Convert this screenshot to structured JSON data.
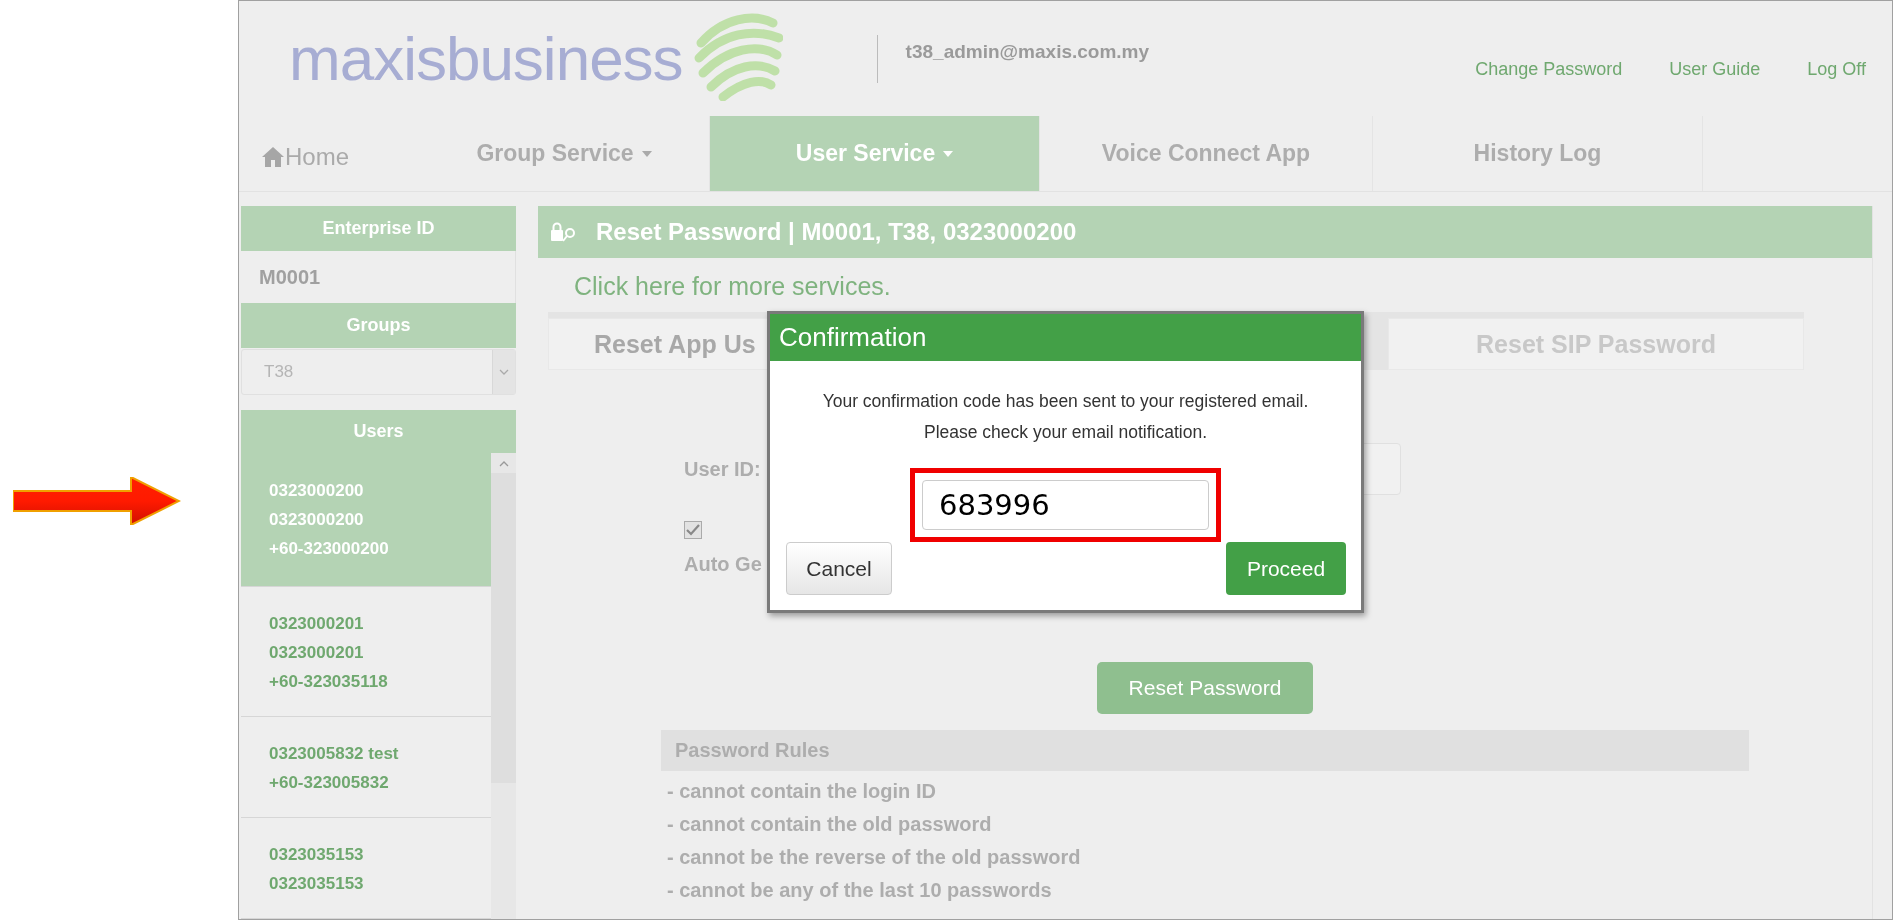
{
  "header": {
    "logo": "**maxis**business",
    "user_email": "t38_admin@maxis.com.my",
    "links": [
      "Change Password",
      "User Guide",
      "Log Off"
    ]
  },
  "nav": [
    {
      "label": "Home",
      "kind": "home",
      "selected": false,
      "dropdown": false
    },
    {
      "label": "Group Service",
      "kind": "menu",
      "selected": false,
      "dropdown": true
    },
    {
      "label": "User Service",
      "kind": "menu",
      "selected": true,
      "dropdown": true
    },
    {
      "label": "Voice Connect App",
      "kind": "menu",
      "selected": false,
      "dropdown": false
    },
    {
      "label": "History Log",
      "kind": "menu",
      "selected": false,
      "dropdown": false
    }
  ],
  "sidebar": {
    "enterprise_header": "Enterprise ID",
    "enterprise_id": "M0001",
    "groups_header": "Groups",
    "group_select": {
      "value": "T38"
    },
    "users_header": "Users",
    "users": [
      {
        "lines": [
          "0323000200",
          "0323000200",
          "+60-323000200"
        ],
        "selected": true
      },
      {
        "lines": [
          "0323000201",
          "0323000201",
          "+60-323035118"
        ],
        "selected": false
      },
      {
        "lines": [
          "0323005832 test",
          "+60-323005832"
        ],
        "selected": false
      },
      {
        "lines": [
          "0323035153",
          "0323035153"
        ],
        "selected": false
      }
    ]
  },
  "main": {
    "title": "Reset Password | M0001, T38, 0323000200",
    "services_link": "Click here for more services.",
    "tabs": [
      {
        "label": "Reset App Us",
        "selected": true
      },
      {
        "label": "Reset SIP Password",
        "selected": false
      }
    ],
    "user_id_label": "User ID:",
    "auto_generate": {
      "label": "Auto Ge",
      "checked": true
    },
    "reset_button": "Reset Password",
    "rules_title": "Password Rules",
    "rules": [
      "- cannot contain the login ID",
      "- cannot contain the old password",
      "- cannot be the reverse of the old password",
      "- cannot be any of the last 10 passwords"
    ]
  },
  "modal": {
    "title": "Confirmation",
    "message": [
      "Your confirmation code has been sent to your registered email.",
      "Please check your email notification."
    ],
    "code": "683996",
    "highlighted": true,
    "cancel": "Cancel",
    "proceed": "Proceed"
  }
}
